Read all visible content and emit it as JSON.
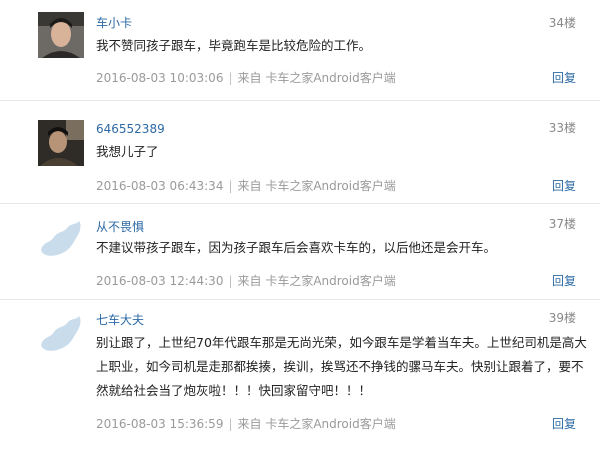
{
  "comments": [
    {
      "username": "车小卡",
      "floor": "34楼",
      "avatar": "photo-user-icon",
      "lines": [
        "我不赞同孩子跟车，毕竟跑车是比较危险的工作。"
      ],
      "time": "2016-08-03 10:03:06",
      "sep": "|",
      "source": "来自 卡车之家Android客户端",
      "reply": "回复"
    },
    {
      "username": "646552389",
      "floor": "33楼",
      "avatar": "photo-user-icon",
      "lines": [
        "我想儿子了"
      ],
      "time": "2016-08-03 06:43:34",
      "sep": "|",
      "source": "来自 卡车之家Android客户端",
      "reply": "回复"
    },
    {
      "username": "从不畏惧",
      "floor": "37楼",
      "avatar": "default-map-avatar-icon",
      "lines": [
        "不建议带孩子跟车，因为孩子跟车后会喜欢卡车的，以后他还是会开车。"
      ],
      "time": "2016-08-03 12:44:30",
      "sep": "|",
      "source": "来自 卡车之家Android客户端",
      "reply": "回复"
    },
    {
      "username": "七车大夫",
      "floor": "39楼",
      "avatar": "default-map-avatar-icon",
      "lines": [
        "别让跟了，上世纪70年代跟车那是无尚光荣，如今跟车是学着当车夫。上世纪司机是高大",
        "上职业，如今司机是走那都挨揍，挨训，挨骂还不挣钱的骡马车夫。快别让跟着了，要不",
        "然就给社会当了炮灰啦！！！快回家留守吧！！！"
      ],
      "time": "2016-08-03 15:36:59",
      "sep": "|",
      "source": "来自 卡车之家Android客户端",
      "reply": "回复"
    }
  ],
  "colors": {
    "username": "#2d6aa5",
    "meta": "#9a9a9a",
    "avatar_map": "#c9dcec"
  }
}
